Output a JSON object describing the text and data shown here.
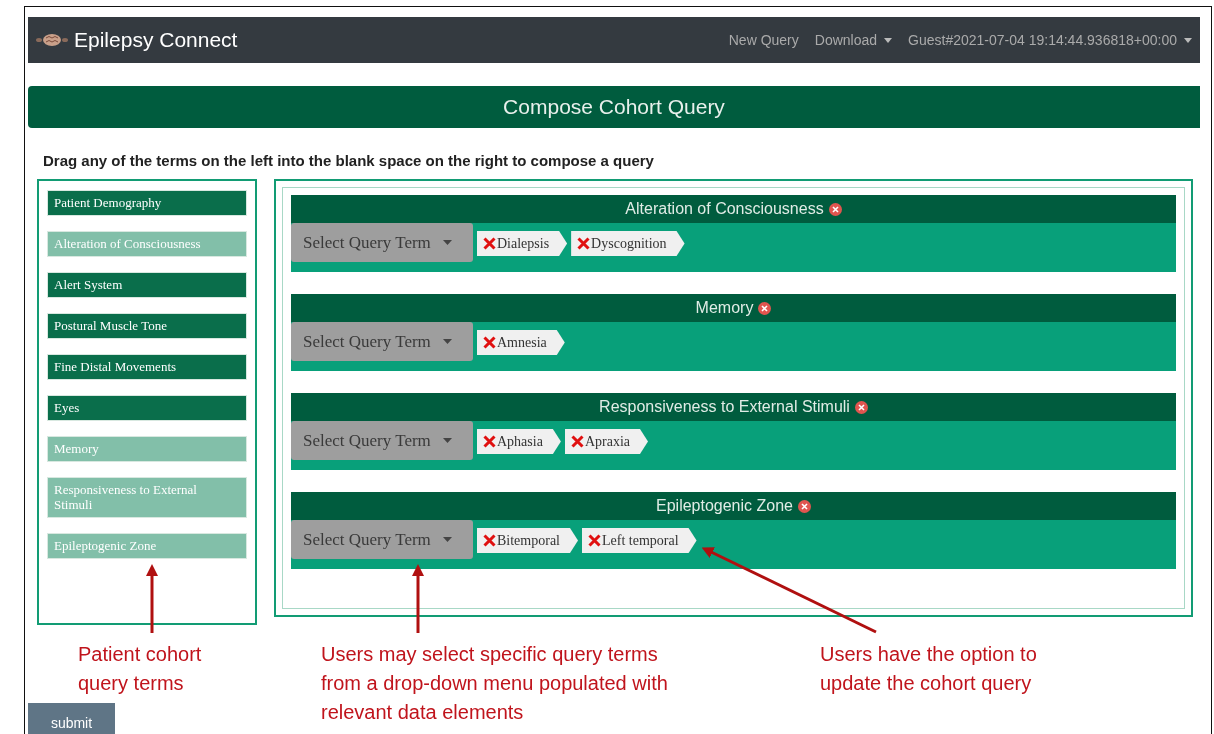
{
  "navbar": {
    "brand": "Epilepsy Connect",
    "links": [
      {
        "label": "New Query",
        "dropdown": false
      },
      {
        "label": "Download",
        "dropdown": true
      },
      {
        "label": "Guest#2021-07-04 19:14:44.936818+00:00",
        "dropdown": true
      }
    ]
  },
  "title": "Compose Cohort Query",
  "instruction": "Drag any of the terms on the left into the blank space on the right to compose a query",
  "terms": [
    {
      "label": "Patient Demography",
      "in_query": false
    },
    {
      "label": "Alteration of Consciousness",
      "in_query": true
    },
    {
      "label": "Alert System",
      "in_query": false
    },
    {
      "label": "Postural Muscle Tone",
      "in_query": false
    },
    {
      "label": "Fine Distal Movements",
      "in_query": false
    },
    {
      "label": "Eyes",
      "in_query": false
    },
    {
      "label": "Memory",
      "in_query": true
    },
    {
      "label": "Responsiveness to External Stimuli",
      "in_query": true
    },
    {
      "label": "Epileptogenic Zone",
      "in_query": true
    }
  ],
  "query_groups": [
    {
      "title": "Alteration of Consciousness",
      "select": "Select Query Term",
      "tags": [
        "Dialepsis",
        "Dyscognition"
      ]
    },
    {
      "title": "Memory",
      "select": "Select Query Term",
      "tags": [
        "Amnesia"
      ]
    },
    {
      "title": "Responsiveness to External Stimuli",
      "select": "Select Query Term",
      "tags": [
        "Aphasia",
        "Apraxia"
      ]
    },
    {
      "title": "Epileptogenic Zone",
      "select": "Select Query Term",
      "tags": [
        "Bitemporal",
        "Left temporal"
      ]
    }
  ],
  "submit": "submit",
  "annotations": [
    "Patient cohort query terms",
    "Users may select specific query terms from a drop-down menu populated with relevant data elements",
    "Users have the option to update the cohort query"
  ]
}
